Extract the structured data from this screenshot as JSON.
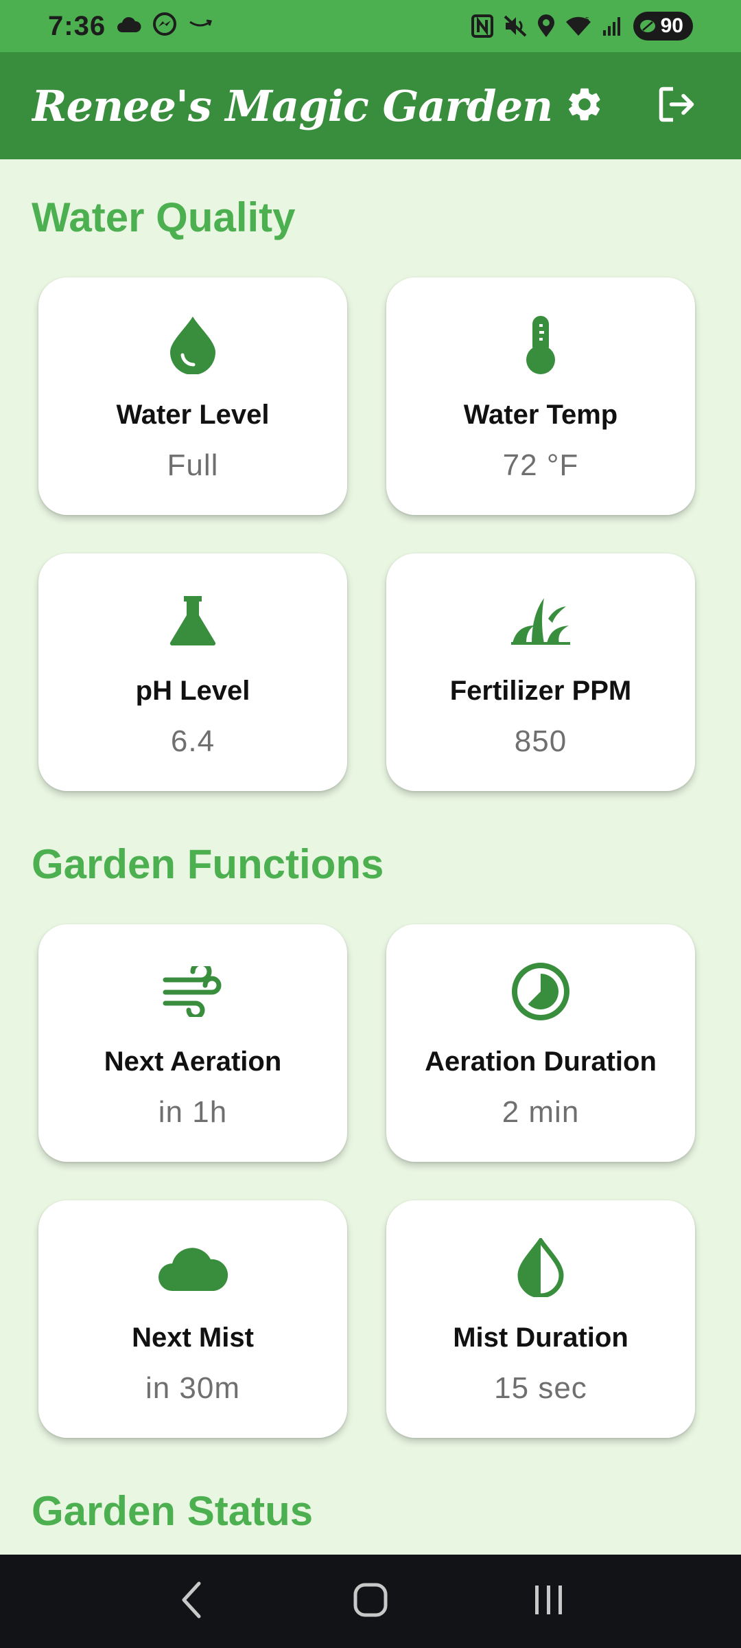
{
  "status_bar": {
    "time": "7:36",
    "battery": "90",
    "icons": [
      "cloud-icon",
      "messenger-icon",
      "amazon-icon",
      "nfc-icon",
      "mute-icon",
      "location-icon",
      "wifi-icon",
      "signal-icon",
      "battery-icon"
    ]
  },
  "app_bar": {
    "title": "Renee's Magic Garden",
    "settings_icon": "gear-icon",
    "logout_icon": "logout-icon"
  },
  "sections": {
    "water_quality": {
      "title": "Water Quality",
      "cards": [
        {
          "label": "Water Level",
          "value": "Full",
          "icon": "water-drop-icon"
        },
        {
          "label": "Water Temp",
          "value": "72 °F",
          "icon": "thermometer-icon"
        },
        {
          "label": "pH Level",
          "value": "6.4",
          "icon": "flask-icon"
        },
        {
          "label": "Fertilizer PPM",
          "value": "850",
          "icon": "grass-icon"
        }
      ]
    },
    "garden_functions": {
      "title": "Garden Functions",
      "cards": [
        {
          "label": "Next Aeration",
          "value": "in 1h",
          "icon": "wind-icon"
        },
        {
          "label": "Aeration Duration",
          "value": "2 min",
          "icon": "timelapse-icon"
        },
        {
          "label": "Next Mist",
          "value": "in 30m",
          "icon": "cloud-icon"
        },
        {
          "label": "Mist Duration",
          "value": "15 sec",
          "icon": "opacity-drop-icon"
        }
      ]
    },
    "garden_status": {
      "title": "Garden Status"
    }
  },
  "nav_bar": {
    "back_icon": "back-icon",
    "home_icon": "home-icon",
    "recents_icon": "recents-icon"
  },
  "colors": {
    "status_bar": "#4caf50",
    "app_bar": "#388e3c",
    "background": "#e9f6e2",
    "accent": "#4caf50",
    "icon": "#388e3c"
  }
}
